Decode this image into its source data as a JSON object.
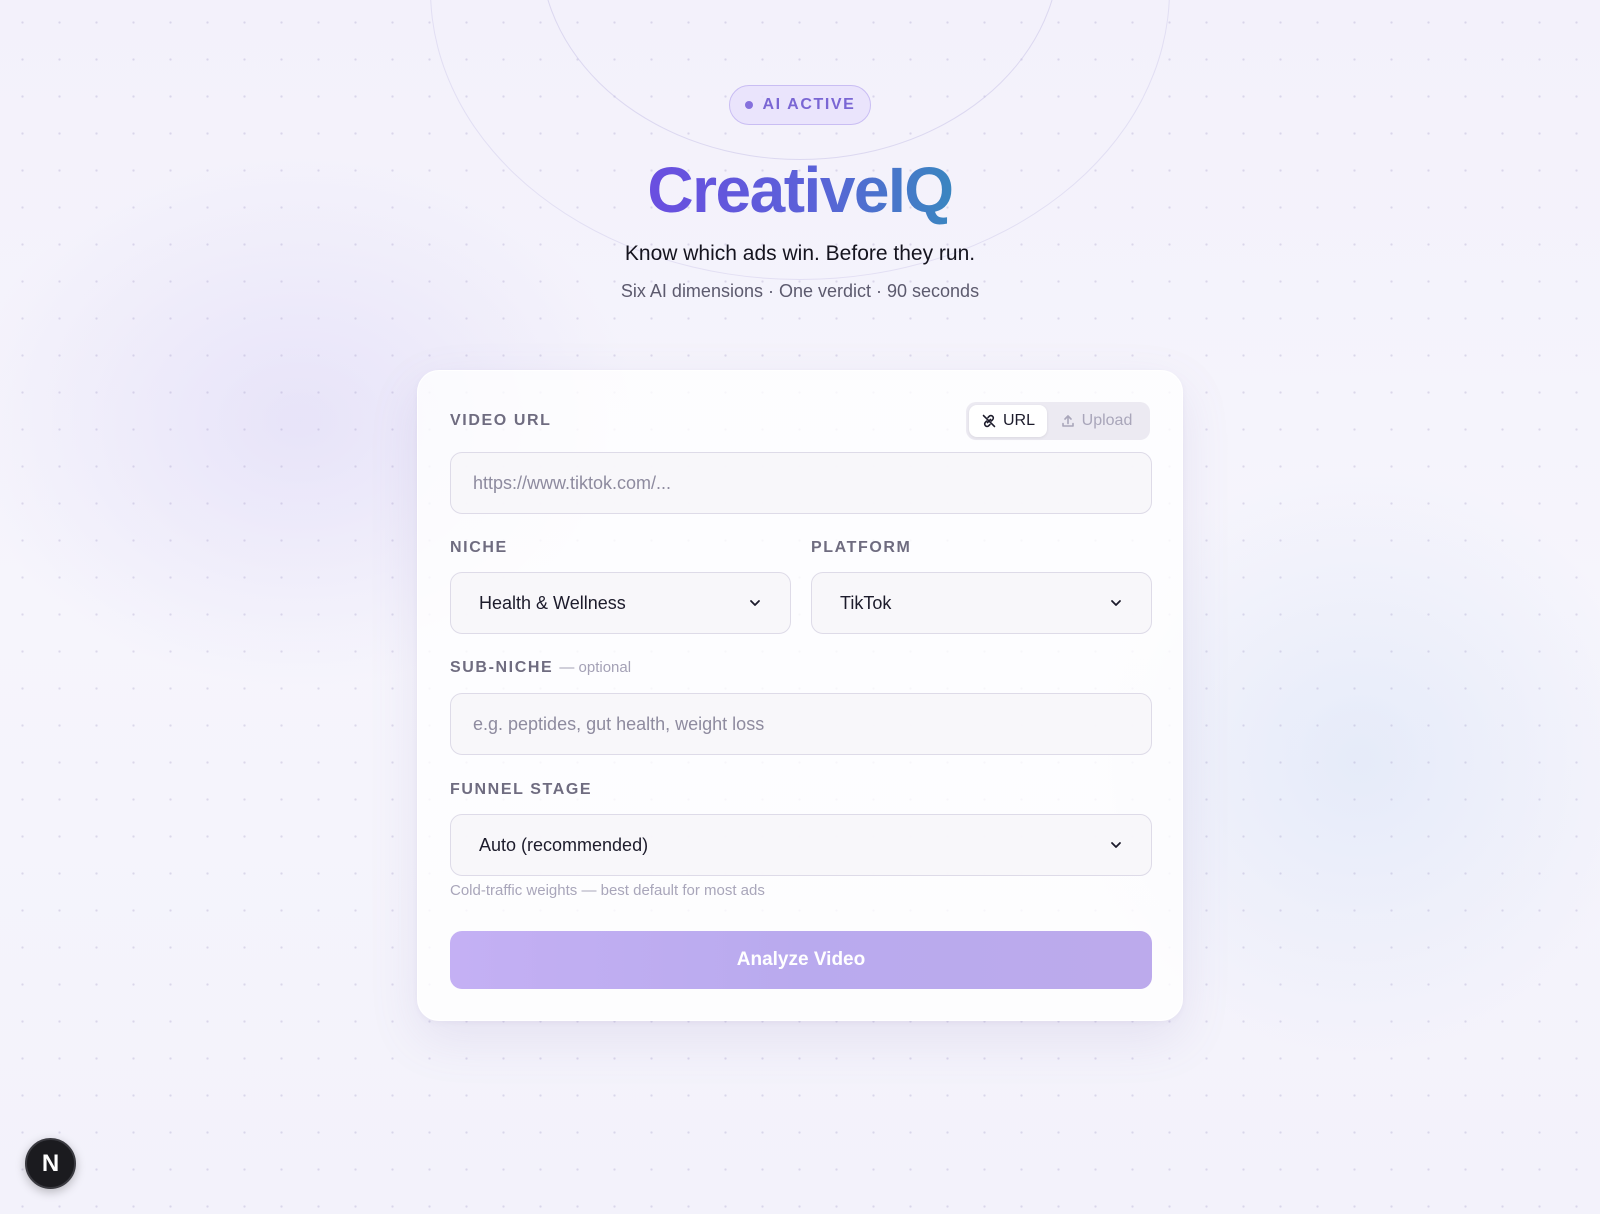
{
  "hero": {
    "badge": "AI ACTIVE",
    "title": "CreativeIQ",
    "tagline": "Know which ads win. Before they run.",
    "subtagline": "Six AI dimensions · One verdict · 90 seconds"
  },
  "form": {
    "video_url": {
      "label": "VIDEO URL",
      "placeholder": "https://www.tiktok.com/...",
      "value": ""
    },
    "source_toggle": {
      "url_label": "URL",
      "upload_label": "Upload",
      "selected": "URL"
    },
    "niche": {
      "label": "NICHE",
      "value": "Health & Wellness"
    },
    "platform": {
      "label": "PLATFORM",
      "value": "TikTok"
    },
    "sub_niche": {
      "label": "SUB-NICHE",
      "optional_note": "— optional",
      "placeholder": "e.g. peptides, gut health, weight loss",
      "value": ""
    },
    "funnel_stage": {
      "label": "FUNNEL STAGE",
      "value": "Auto (recommended)",
      "hint": "Cold-traffic weights — best default for most ads"
    },
    "submit_label": "Analyze Video"
  },
  "devtools": {
    "badge_letter": "N"
  },
  "colors": {
    "accent": "#6a4ee0",
    "accent_alt": "#3a86c0",
    "button": "#c4b0f4",
    "badge_text": "#7a66d4"
  },
  "icons": {
    "url_toggle": "link-off-icon",
    "upload_toggle": "upload-icon",
    "select": "chevron-down-icon"
  }
}
